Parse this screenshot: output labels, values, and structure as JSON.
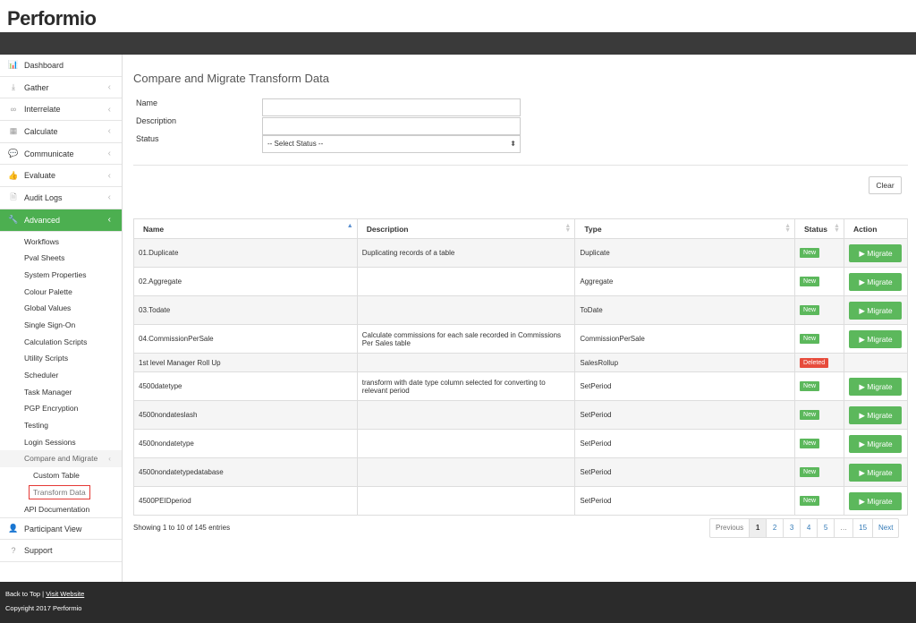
{
  "brand": {
    "logo": "Performio"
  },
  "sidebar": {
    "items": [
      {
        "label": "Dashboard",
        "icon": "bar-chart-icon",
        "glyph": "📊",
        "chevron": false
      },
      {
        "label": "Gather",
        "icon": "download-icon",
        "glyph": "⤓",
        "chevron": true
      },
      {
        "label": "Interrelate",
        "icon": "link-icon",
        "glyph": "∞",
        "chevron": true
      },
      {
        "label": "Calculate",
        "icon": "calculator-icon",
        "glyph": "▦",
        "chevron": true
      },
      {
        "label": "Communicate",
        "icon": "chat-icon",
        "glyph": "💬",
        "chevron": true
      },
      {
        "label": "Evaluate",
        "icon": "thumbs-up-icon",
        "glyph": "👍",
        "chevron": true
      },
      {
        "label": "Audit Logs",
        "icon": "document-icon",
        "glyph": "🗎",
        "chevron": true
      },
      {
        "label": "Advanced",
        "icon": "wrench-icon",
        "glyph": "🔧",
        "chevron": true
      }
    ],
    "advanced_sub": [
      "Workflows",
      "Pval Sheets",
      "System Properties",
      "Colour Palette",
      "Global Values",
      "Single Sign-On",
      "Calculation Scripts",
      "Utility Scripts",
      "Scheduler",
      "Task Manager",
      "PGP Encryption",
      "Testing",
      "Login Sessions"
    ],
    "compare_section": "Compare and Migrate",
    "compare_sub": [
      "Custom Table",
      "Transform Data"
    ],
    "api_doc": "API Documentation",
    "participant_view": "Participant View",
    "support": "Support"
  },
  "page": {
    "title": "Compare and Migrate Transform Data",
    "name_label": "Name",
    "description_label": "Description",
    "status_label": "Status",
    "status_select": "-- Select Status --",
    "clear_label": "Clear"
  },
  "table": {
    "columns": [
      "Name",
      "Description",
      "Type",
      "Status",
      "Action"
    ],
    "migrate_label": "▶ Migrate",
    "rows": [
      {
        "name": "01.Duplicate",
        "description": "Duplicating records of a table",
        "type": "Duplicate",
        "status": "New",
        "action": true
      },
      {
        "name": "02.Aggregate",
        "description": "",
        "type": "Aggregate",
        "status": "New",
        "action": true
      },
      {
        "name": "03.Todate",
        "description": "",
        "type": "ToDate",
        "status": "New",
        "action": true
      },
      {
        "name": "04.CommissionPerSale",
        "description": "Calculate commissions for each sale recorded in Commissions Per Sales table",
        "type": "CommissionPerSale",
        "status": "New",
        "action": true
      },
      {
        "name": "1st level Manager Roll Up",
        "description": "",
        "type": "SalesRollup",
        "status": "Deleted",
        "action": false
      },
      {
        "name": "4500datetype",
        "description": "transform with date type column selected for converting to relevant period",
        "type": "SetPeriod",
        "status": "New",
        "action": true
      },
      {
        "name": "4500nondateslash",
        "description": "",
        "type": "SetPeriod",
        "status": "New",
        "action": true
      },
      {
        "name": "4500nondatetype",
        "description": "",
        "type": "SetPeriod",
        "status": "New",
        "action": true
      },
      {
        "name": "4500nondatetypedatabase",
        "description": "",
        "type": "SetPeriod",
        "status": "New",
        "action": true
      },
      {
        "name": "4500PEIDperiod",
        "description": "",
        "type": "SetPeriod",
        "status": "New",
        "action": true
      }
    ],
    "entries_text": "Showing 1 to 10 of 145 entries"
  },
  "pagination": {
    "previous": "Previous",
    "pages": [
      "1",
      "2",
      "3",
      "4",
      "5",
      "…",
      "15"
    ],
    "current": "1",
    "next": "Next"
  },
  "footer": {
    "back_to_top": "Back to Top",
    "separator": " | ",
    "visit_website": "Visit Website",
    "copyright": "Copyright 2017 Performio"
  },
  "colors": {
    "accent": "#4caf50",
    "migrate": "#5cb85c",
    "deleted": "#e74c3c",
    "dark_bar": "#3a3a3a",
    "footer": "#2b2b2b"
  }
}
